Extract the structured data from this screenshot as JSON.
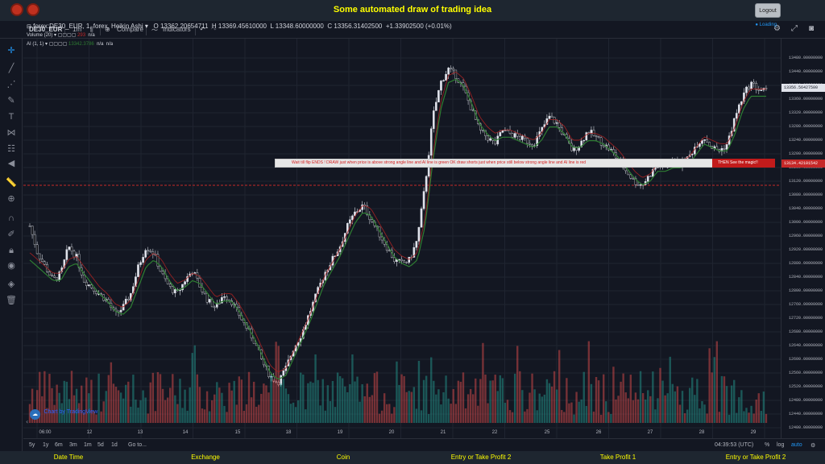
{
  "header": {
    "title": "Some automated draw of trading idea",
    "logout_label": "Logout",
    "logo_icons": [
      "brand-head-icon",
      "brand-head-icon"
    ]
  },
  "toolbar": {
    "symbol": "DE30_EUR",
    "interval": "1m",
    "compare_label": "Compare",
    "indicators_label": "Indicators"
  },
  "legend": {
    "title": "forex:DE30_EUR, 1, forex, Heikin Ashi",
    "open": "O 13362.20654711",
    "high": "H 13369.45610000",
    "low": "L 13348.60000000",
    "close": "C 13356.31402500",
    "change": "+1.33902500 (+0.01%)",
    "volume_label": "Volume (20)",
    "volume_value": "293",
    "volume_na": "n/a",
    "ai_label": "AI (1, 1)",
    "ai_value": "13342.3786",
    "ai_na1": "n/a",
    "ai_na2": "n/a",
    "loading": "Loading"
  },
  "drawing": {
    "text": "Wait till flip ENDS !   DRAW just when  price is above strong angle line and AI line is green          OK          draw shorts just when price still below strong angle line and AI line is red",
    "magic": "THEN See the magic!!"
  },
  "price_axis": {
    "ticks": [
      "13480.00000000",
      "13440.00000000",
      "13400.00000000",
      "13360.00000000",
      "13320.00000000",
      "13280.00000000",
      "13240.00000000",
      "13200.00000000",
      "13160.00000000",
      "13120.00000000",
      "13080.00000000",
      "13040.00000000",
      "13000.00000000",
      "12960.00000000",
      "12920.00000000",
      "12880.00000000",
      "12840.00000000",
      "12800.00000000",
      "12760.00000000",
      "12720.00000000",
      "12680.00000000",
      "12640.00000000",
      "12600.00000000",
      "12560.00000000",
      "12520.00000000",
      "12480.00000000",
      "12440.00000000",
      "12400.00000000"
    ],
    "current_price": "13356.56427500",
    "line_price": "13134.42101542"
  },
  "time_axis": {
    "ticks": [
      "06:00",
      "12",
      "13",
      "14",
      "15",
      "18",
      "19",
      "20",
      "21",
      "22",
      "25",
      "26",
      "27",
      "28",
      "29"
    ]
  },
  "bottombar": {
    "ranges": [
      "5y",
      "1y",
      "6m",
      "3m",
      "1m",
      "5d",
      "1d"
    ],
    "goto": "Go to...",
    "clock": "04:39:53 (UTC)",
    "percent": "%",
    "log": "log",
    "auto": "auto"
  },
  "tv_logo_text": "Chart by TradingView",
  "footer": {
    "items": [
      "Date Time",
      "Exchange",
      "Coin",
      "Entry or Take Profit 2",
      "Take Profit 1",
      "Entry or Take Profit 2"
    ]
  },
  "colors": {
    "up": "#4caf50",
    "down": "#c62828",
    "accent": "#2196f3",
    "title": "#ffff00"
  },
  "chart_data": {
    "type": "candlestick",
    "ylim": [
      12380,
      13490
    ],
    "price_series": [
      12960,
      12880,
      12840,
      12800,
      12820,
      12900,
      12870,
      12800,
      12780,
      12760,
      12740,
      12700,
      12720,
      12760,
      12840,
      12900,
      12880,
      12820,
      12780,
      12760,
      12800,
      12830,
      12780,
      12740,
      12720,
      12760,
      12740,
      12700,
      12660,
      12620,
      12560,
      12520,
      12500,
      12540,
      12600,
      12640,
      12700,
      12760,
      12820,
      12860,
      12900,
      12960,
      13000,
      13020,
      12980,
      12940,
      12900,
      12860,
      12850,
      12860,
      12920,
      13080,
      13280,
      13380,
      13420,
      13400,
      13360,
      13300,
      13240,
      13220,
      13200,
      13240,
      13230,
      13220,
      13210,
      13200,
      13240,
      13280,
      13260,
      13220,
      13180,
      13200,
      13240,
      13220,
      13200,
      13180,
      13150,
      13120,
      13090,
      13080,
      13110,
      13140,
      13130,
      13150,
      13140,
      13160,
      13200,
      13220,
      13190,
      13180,
      13200,
      13280,
      13340,
      13380,
      13360,
      13356
    ],
    "ai_series": [
      12860,
      12840,
      12820,
      12800,
      12800,
      12840,
      12850,
      12820,
      12790,
      12760,
      12740,
      12710,
      12700,
      12720,
      12780,
      12840,
      12860,
      12840,
      12800,
      12770,
      12780,
      12800,
      12790,
      12760,
      12730,
      12740,
      12740,
      12710,
      12670,
      12630,
      12580,
      12530,
      12510,
      12520,
      12570,
      12620,
      12670,
      12730,
      12790,
      12830,
      12870,
      12920,
      12970,
      13000,
      12990,
      12950,
      12910,
      12870,
      12850,
      12840,
      12860,
      12960,
      13150,
      13300,
      13380,
      13390,
      13370,
      13320,
      13260,
      13230,
      13210,
      13220,
      13220,
      13210,
      13200,
      13190,
      13210,
      13250,
      13250,
      13230,
      13190,
      13190,
      13210,
      13210,
      13200,
      13180,
      13160,
      13130,
      13100,
      13080,
      13090,
      13120,
      13120,
      13130,
      13130,
      13140,
      13170,
      13200,
      13190,
      13180,
      13180,
      13230,
      13300,
      13340,
      13340,
      13340
    ]
  }
}
